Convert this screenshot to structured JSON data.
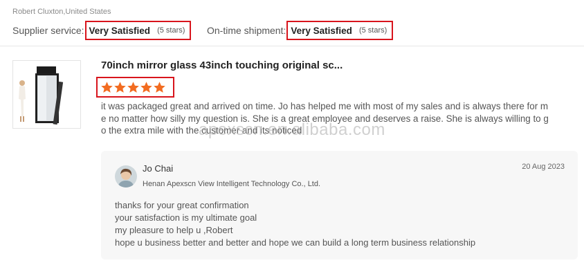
{
  "review": {
    "reviewer": "Robert Cluxton,United States",
    "ratings": [
      {
        "label": "Supplier service:",
        "value": "Very Satisfied",
        "stars_text": "(5 stars)"
      },
      {
        "label": "On-time shipment:",
        "value": "Very Satisfied",
        "stars_text": "(5 stars)"
      }
    ],
    "product_title": "70inch mirror glass 43inch touching original sc...",
    "star_rating": 5,
    "star_color": "#f26c21",
    "text": "it was packaged great and arrived on time. Jo has helped me with most of my sales and is always there for me no matter how silly my question is. She is a great employee and deserves a raise. She is always willing to go the extra mile with the customer and its noticed"
  },
  "watermark": "apexscn.en.alibaba.com",
  "reply": {
    "name": "Jo Chai",
    "company": "Henan Apexscn View Intelligent Technology Co., Ltd.",
    "date": "20 Aug 2023",
    "lines": [
      "thanks for your great confirmation",
      "your satisfaction is my ultimate goal",
      "my pleasure to help u ,Robert",
      "hope u business better and better and hope we can build a long term business relationship"
    ]
  },
  "colors": {
    "highlight_border": "#d8141c",
    "card_bg": "#f7f7f7"
  }
}
